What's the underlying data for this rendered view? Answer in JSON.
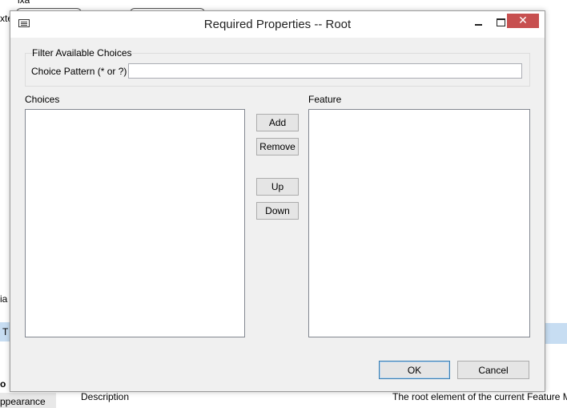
{
  "background": {
    "top_text": "ixa",
    "left_fragments": [
      "xte",
      "ia",
      "T",
      "o"
    ],
    "bottom_left_label": "ppearance",
    "bottom_center_label": "Description",
    "bottom_right_text": "The root element of the current Feature M"
  },
  "dialog": {
    "title": "Required Properties -- Root",
    "minimize_label": "",
    "maximize_label": "",
    "close_label": "✕",
    "filter": {
      "group_label": "Filter Available Choices",
      "pattern_label": "Choice Pattern (* or ?)",
      "pattern_value": "",
      "pattern_placeholder": ""
    },
    "choices_label": "Choices",
    "feature_label": "Feature",
    "choices_items": [],
    "feature_items": [],
    "buttons": {
      "add": "Add",
      "remove": "Remove",
      "up": "Up",
      "down": "Down",
      "ok": "OK",
      "cancel": "Cancel"
    }
  }
}
